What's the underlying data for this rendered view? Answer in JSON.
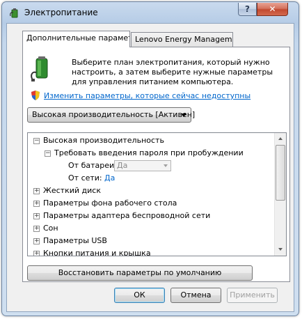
{
  "window": {
    "title": "Электропитание",
    "help_label": "?",
    "close_label": "✕"
  },
  "tabs": [
    {
      "label": "Дополнительные параметры",
      "active": true
    },
    {
      "label": "Lenovo Energy Management",
      "active": false
    }
  ],
  "intro": {
    "text": "Выберите план электропитания, который нужно настроить, а затем выберите нужные параметры для управления питанием компьютера.",
    "change_link": "Изменить параметры, которые сейчас недоступны"
  },
  "plan_select": {
    "value": "Высокая производительность [Активен]"
  },
  "tree": {
    "root": {
      "label": "Высокая производительность",
      "expander": "−"
    },
    "password": {
      "label": "Требовать введения пароля при пробуждении",
      "expander": "−"
    },
    "on_battery": {
      "label": "От батареи:",
      "value": "Да"
    },
    "plugged_in": {
      "label": "От сети:",
      "value": "Да"
    },
    "items": [
      {
        "label": "Жесткий диск",
        "expander": "+"
      },
      {
        "label": "Параметры фона рабочего стола",
        "expander": "+"
      },
      {
        "label": "Параметры адаптера беспроводной сети",
        "expander": "+"
      },
      {
        "label": "Сон",
        "expander": "+"
      },
      {
        "label": "Параметры USB",
        "expander": "+"
      },
      {
        "label": "Кнопки питания и крышка",
        "expander": "+"
      }
    ]
  },
  "buttons": {
    "restore": "Восстановить параметры по умолчанию",
    "ok": "ОК",
    "cancel": "Отмена",
    "apply": "Применить"
  }
}
